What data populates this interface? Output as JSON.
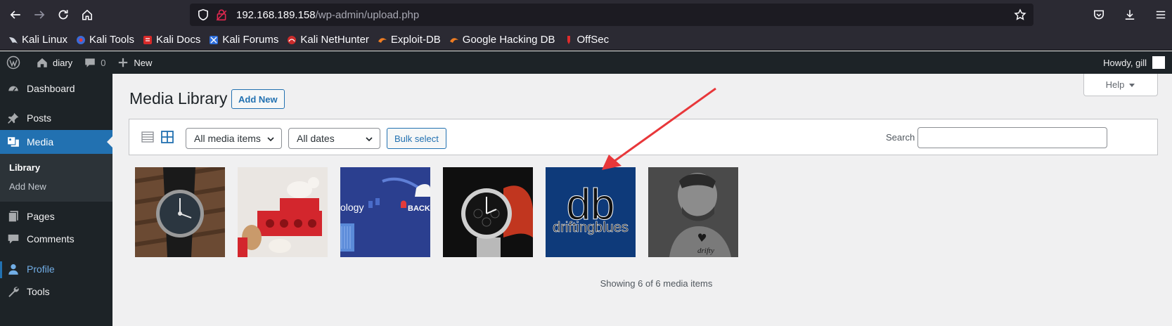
{
  "browser": {
    "url_host": "192.168.189.158",
    "url_path": "/wp-admin/upload.php",
    "bookmarks": [
      {
        "label": "Kali Linux",
        "icon": "kali-dragon-icon"
      },
      {
        "label": "Kali Tools",
        "icon": "kali-tools-icon"
      },
      {
        "label": "Kali Docs",
        "icon": "kali-docs-icon"
      },
      {
        "label": "Kali Forums",
        "icon": "kali-forums-icon"
      },
      {
        "label": "Kali NetHunter",
        "icon": "nethunter-icon"
      },
      {
        "label": "Exploit-DB",
        "icon": "exploit-db-icon"
      },
      {
        "label": "Google Hacking DB",
        "icon": "ghdb-icon"
      },
      {
        "label": "OffSec",
        "icon": "offsec-icon"
      }
    ]
  },
  "adminbar": {
    "site_name": "diary",
    "comments_count": "0",
    "new_label": "New",
    "howdy": "Howdy, gill"
  },
  "sidebar": {
    "items": [
      {
        "label": "Dashboard"
      },
      {
        "label": "Posts"
      },
      {
        "label": "Media"
      },
      {
        "label": "Pages"
      },
      {
        "label": "Comments"
      },
      {
        "label": "Profile"
      },
      {
        "label": "Tools"
      }
    ],
    "media_submenu": [
      "Library",
      "Add New"
    ]
  },
  "main": {
    "title": "Media Library",
    "add_new": "Add New",
    "help": "Help",
    "filter_type": "All media items",
    "filter_date": "All dates",
    "bulk_select": "Bulk select",
    "search_label": "Search",
    "search_value": "",
    "thumb_texts": {
      "blog": "ology",
      "back": "BACK",
      "db_logo": "db",
      "db_name": "driftingblues",
      "tattoo": "drifty"
    },
    "showing": "Showing 6 of 6 media items"
  },
  "colors": {
    "accent": "#2271b1",
    "adminbar": "#1d2327",
    "arrow": "#e8373a",
    "driftingblues_bg": "#0e3a7a"
  }
}
